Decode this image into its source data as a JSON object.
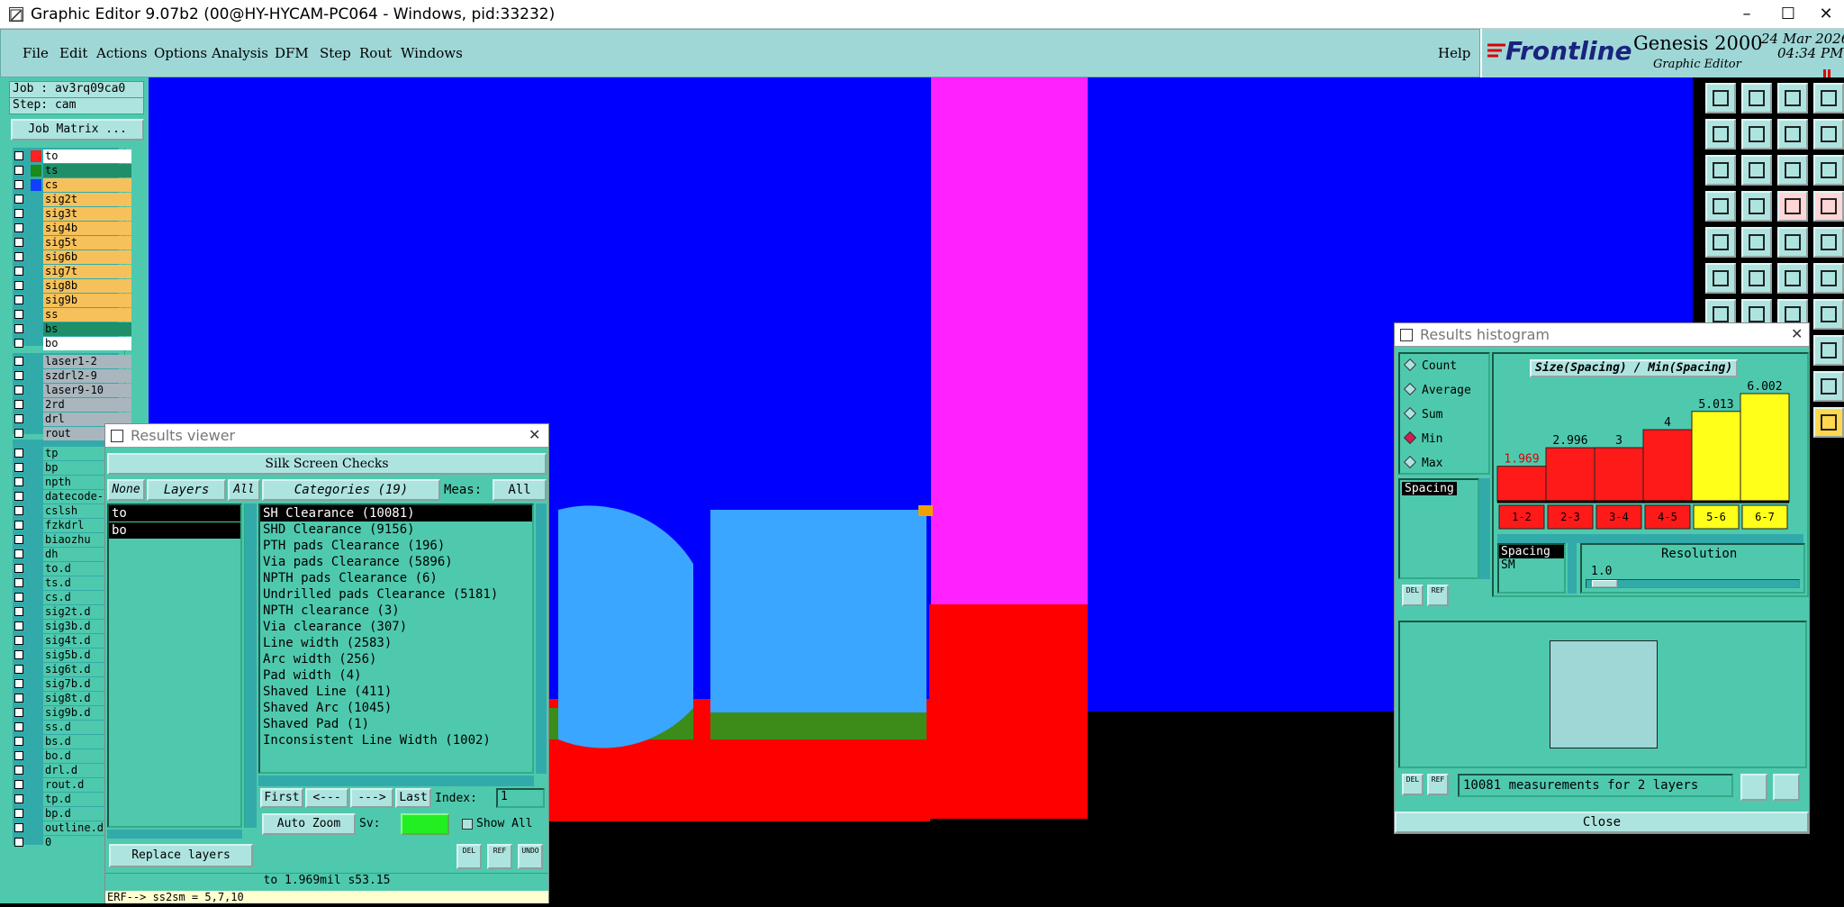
{
  "window": {
    "title": "Graphic Editor 9.07b2 (00@HY-HYCAM-PC064 - Windows, pid:33232)",
    "controls": [
      "–",
      "☐",
      "✕"
    ]
  },
  "menu": {
    "items": [
      "File",
      "Edit",
      "Actions",
      "Options",
      "Analysis",
      "DFM",
      "Step",
      "Rout",
      "Windows"
    ],
    "help": "Help"
  },
  "brand": {
    "logo": "Frontline",
    "product": "Genesis 2000",
    "subtitle": "Graphic Editor",
    "date": "24 Mar 2026",
    "time": "04:34 PM"
  },
  "job": {
    "job_label": "Job : av3rq09ca0",
    "step_label": "Step: cam",
    "matrix_button": "Job Matrix ..."
  },
  "layers_group1": [
    {
      "name": "to",
      "swatch": "#ff2020",
      "bg": "#ffffff"
    },
    {
      "name": "ts",
      "swatch": "#1a8a1a",
      "bg": "#1f8f6a"
    },
    {
      "name": "cs",
      "swatch": "#1040ff",
      "bg": "#f6c15a"
    },
    {
      "name": "sig2t",
      "swatch": "",
      "bg": "#f6c15a"
    },
    {
      "name": "sig3t",
      "swatch": "",
      "bg": "#f6c15a"
    },
    {
      "name": "sig4b",
      "swatch": "",
      "bg": "#f6c15a"
    },
    {
      "name": "sig5t",
      "swatch": "",
      "bg": "#f6c15a"
    },
    {
      "name": "sig6b",
      "swatch": "",
      "bg": "#f6c15a"
    },
    {
      "name": "sig7t",
      "swatch": "",
      "bg": "#f6c15a"
    },
    {
      "name": "sig8b",
      "swatch": "",
      "bg": "#f6c15a"
    },
    {
      "name": "sig9b",
      "swatch": "",
      "bg": "#f6c15a"
    },
    {
      "name": "ss",
      "swatch": "",
      "bg": "#f6c15a"
    },
    {
      "name": "bs",
      "swatch": "",
      "bg": "#1f8f6a"
    },
    {
      "name": "bo",
      "swatch": "",
      "bg": "#ffffff"
    }
  ],
  "layers_group2": [
    "laser1-2",
    "szdrl2-9",
    "laser9-10",
    "2rd",
    "drl",
    "rout"
  ],
  "layers_group3": [
    "tp",
    "bp",
    "npth",
    "datecode-",
    "cslsh",
    "fzkdrl",
    "biaozhu",
    "dh",
    "to.d",
    "ts.d",
    "cs.d",
    "sig2t.d",
    "sig3b.d",
    "sig4t.d",
    "sig5b.d",
    "sig6t.d",
    "sig7b.d",
    "sig8t.d",
    "sig9b.d",
    "ss.d",
    "bs.d",
    "bo.d",
    "drl.d",
    "rout.d",
    "tp.d",
    "bp.d",
    "outline.d",
    "0"
  ],
  "results_viewer": {
    "title": "Results viewer",
    "header": "Silk Screen Checks",
    "none_btn": "None",
    "layers_btn": "Layers",
    "all_btn": "All",
    "categories_btn": "Categories (19)",
    "meas_label": "Meas:",
    "meas_value": "All",
    "layers": [
      "to",
      "bo"
    ],
    "categories": [
      "SH Clearance (10081)",
      "SHD Clearance (9156)",
      "PTH pads Clearance (196)",
      "Via pads Clearance (5896)",
      "NPTH pads Clearance (6)",
      "Undrilled pads Clearance (5181)",
      "NPTH clearance (3)",
      "Via clearance (307)",
      "Line width (2583)",
      "Arc width (256)",
      "Pad width (4)",
      "Shaved Line (411)",
      "Shaved Arc (1045)",
      "Shaved Pad (1)",
      "Inconsistent Line Width (1002)"
    ],
    "nav": {
      "first": "First",
      "prev": "<---",
      "next": "--->",
      "last": "Last",
      "index_label": "Index:",
      "index_value": "1"
    },
    "auto_zoom": "Auto Zoom",
    "sv_label": "Sv:",
    "show_all": "Show All",
    "replace_layers": "Replace layers",
    "icon_btns": [
      "DEL",
      "REF",
      "UNDO"
    ],
    "status": "to 1.969mil  s53.15",
    "err": "ERF--> ss2sm = 5,7,10"
  },
  "histogram": {
    "title": "Results histogram",
    "radio": [
      "Count",
      "Average",
      "Sum",
      "Min",
      "Max"
    ],
    "selected_radio": "Min",
    "chart_title": "Size(Spacing) / Min(Spacing)",
    "list_item": "Spacing",
    "bars": [
      {
        "value": "1.969",
        "label": "1-2",
        "color": "#ff1a1a"
      },
      {
        "value": "2.996",
        "label": "2-3",
        "color": "#ff1a1a"
      },
      {
        "value": "3",
        "label": "3-4",
        "color": "#ff1a1a"
      },
      {
        "value": "4",
        "label": "4-5",
        "color": "#ff1a1a"
      },
      {
        "value": "5.013",
        "label": "5-6",
        "color": "#ffff1a"
      },
      {
        "value": "6.002",
        "label": "6-7",
        "color": "#ffff1a"
      }
    ],
    "lower_list": [
      "Spacing",
      "SM"
    ],
    "resolution_label": "Resolution",
    "resolution_value": "1.0",
    "measurements": "10081 measurements for 2 layers",
    "close": "Close"
  }
}
